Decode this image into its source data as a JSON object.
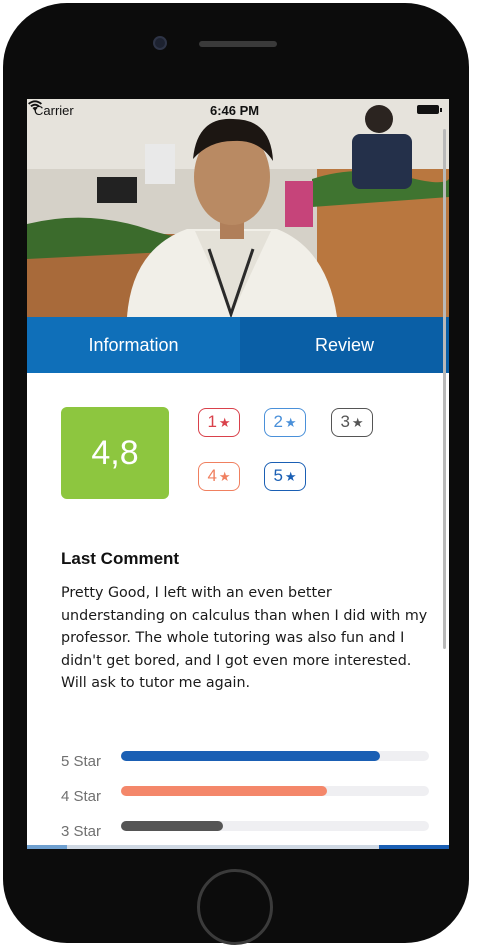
{
  "status_bar": {
    "carrier": "Carrier",
    "time": "6:46 PM"
  },
  "tabs": [
    {
      "label": "Information",
      "active": false
    },
    {
      "label": "Review",
      "active": true
    }
  ],
  "rating": {
    "value": "4,8",
    "color": "#8dc63f"
  },
  "star_filters": [
    {
      "label": "1",
      "color": "#d9414b"
    },
    {
      "label": "2",
      "color": "#4a90d9"
    },
    {
      "label": "3",
      "color": "#555555"
    },
    {
      "label": "4",
      "color": "#f08060"
    },
    {
      "label": "5",
      "color": "#1a5fb4"
    }
  ],
  "comment": {
    "title": "Last Comment",
    "body": "Pretty Good, I left with an even better understanding on calculus than when I did with my professor. The whole tutoring was also fun and I didn't get bored, and I got even more interested. Will ask to tutor me again."
  },
  "distribution": [
    {
      "label": "5 Star",
      "fraction": 0.84,
      "color": "#1a5fb4"
    },
    {
      "label": "4 Star",
      "fraction": 0.67,
      "color": "#f4876a"
    },
    {
      "label": "3 Star",
      "fraction": 0.33,
      "color": "#555555"
    }
  ]
}
